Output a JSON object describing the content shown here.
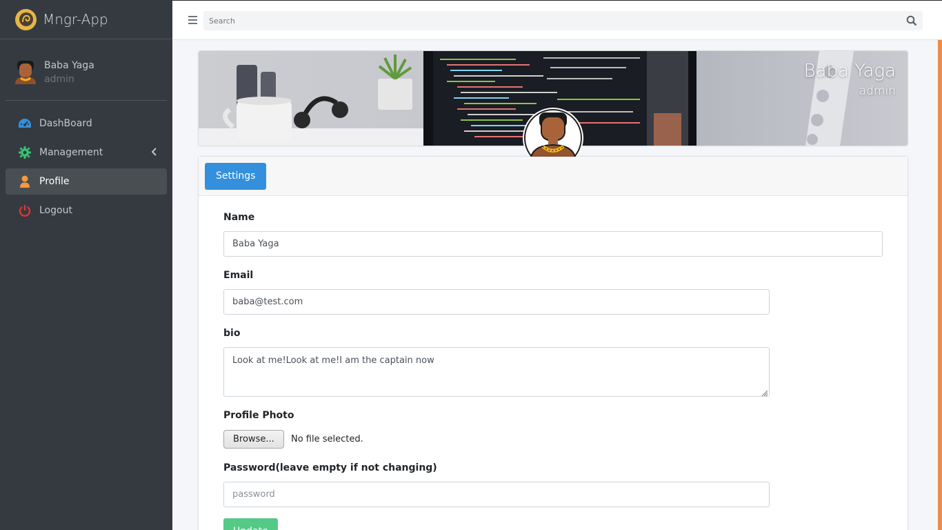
{
  "brand": {
    "name": "Mngr-App"
  },
  "user": {
    "name": "Baba Yaga",
    "role": "admin"
  },
  "sidebar": {
    "items": [
      {
        "label": "DashBoard",
        "icon": "dashboard-icon",
        "color": "#3490dc"
      },
      {
        "label": "Management",
        "icon": "gear-icon",
        "color": "#38c172"
      },
      {
        "label": "Profile",
        "icon": "user-icon",
        "color": "#f6993f"
      },
      {
        "label": "Logout",
        "icon": "power-icon",
        "color": "#e3342f"
      }
    ]
  },
  "topbar": {
    "search_placeholder": "Search"
  },
  "cover": {
    "name": "Baba Yaga",
    "role": "admin"
  },
  "tabs": {
    "settings_label": "Settings"
  },
  "form": {
    "name_label": "Name",
    "name_value": "Baba Yaga",
    "email_label": "Email",
    "email_value": "baba@test.com",
    "bio_label": "bio",
    "bio_value": "Look at me!Look at me!I am the captain now",
    "photo_label": "Profile Photo",
    "browse_label": "Browse...",
    "file_status": "No file selected.",
    "password_label": "Password(leave empty if not changing)",
    "password_placeholder": "password",
    "update_label": "Update"
  },
  "colors": {
    "accent": "#3490dc",
    "success": "#38c172",
    "sidebar": "#343a40"
  }
}
